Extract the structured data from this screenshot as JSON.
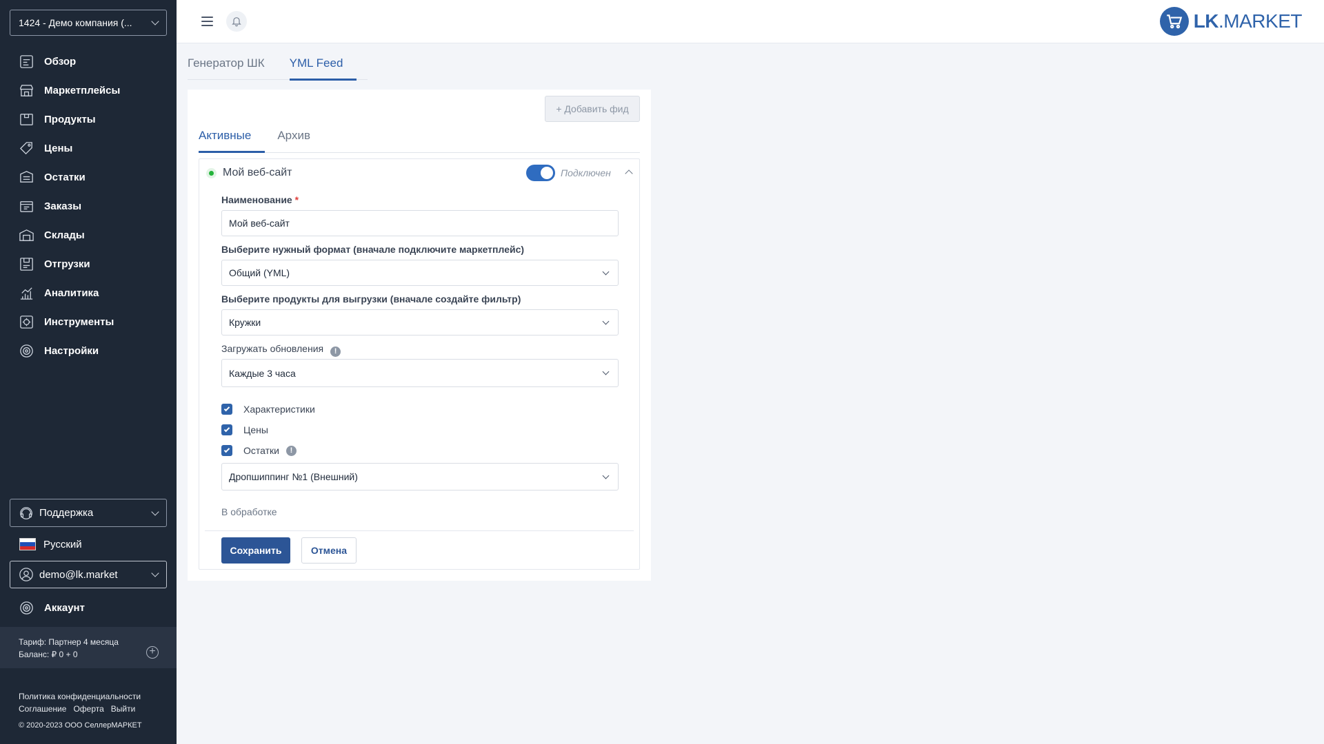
{
  "sidebar": {
    "company": "1424 - Демо компания (...",
    "items": [
      {
        "label": "Обзор",
        "icon": "overview-icon"
      },
      {
        "label": "Маркетплейсы",
        "icon": "marketplaces-icon"
      },
      {
        "label": "Продукты",
        "icon": "products-icon"
      },
      {
        "label": "Цены",
        "icon": "prices-icon"
      },
      {
        "label": "Остатки",
        "icon": "stock-icon"
      },
      {
        "label": "Заказы",
        "icon": "orders-icon"
      },
      {
        "label": "Склады",
        "icon": "warehouses-icon"
      },
      {
        "label": "Отгрузки",
        "icon": "shipments-icon"
      },
      {
        "label": "Аналитика",
        "icon": "analytics-icon"
      },
      {
        "label": "Инструменты",
        "icon": "tools-icon"
      },
      {
        "label": "Настройки",
        "icon": "settings-icon"
      }
    ],
    "support": "Поддержка",
    "language": "Русский",
    "user": "demo@lk.market",
    "account": "Аккаунт",
    "tariff": "Тариф: Партнер 4 месяца",
    "balance": "Баланс: ₽ 0 + 0",
    "links": {
      "privacy": "Политика конфиденциальности",
      "agreement": "Соглашение",
      "offer": "Оферта",
      "logout": "Выйти"
    },
    "copyright": "© 2020-2023 ООО СеллерМАРКЕТ"
  },
  "header": {
    "logo_bold": "LK",
    "logo_rest": ".MARKET"
  },
  "top_tabs": [
    "Генератор ШК",
    "YML Feed"
  ],
  "card": {
    "add_feed": "+ Добавить фид",
    "sub_tabs": [
      "Активные",
      "Архив"
    ],
    "feed": {
      "title": "Мой веб-сайт",
      "toggle_label": "Подключен",
      "connected": true,
      "name_label": "Наименование",
      "name_required": "*",
      "name_value": "Мой веб-сайт",
      "format_label": "Выберите нужный формат (вначале подключите маркетплейс)",
      "format_value": "Общий (YML)",
      "products_label": "Выберите продукты для выгрузки (вначале создайте фильтр)",
      "products_value": "Кружки",
      "updates_label": "Загружать обновления",
      "updates_value": "Каждые 3 часа",
      "checks": [
        "Характеристики",
        "Цены",
        "Остатки"
      ],
      "warehouse_value": "Дропшиппинг №1 (Внешний)",
      "status": "В обработке",
      "save": "Сохранить",
      "cancel": "Отмена"
    }
  },
  "colors": {
    "sidebar_bg": "#1e2836",
    "accent": "#2c5ea8",
    "brand": "#2f63aa",
    "status_green": "#23b33a"
  }
}
